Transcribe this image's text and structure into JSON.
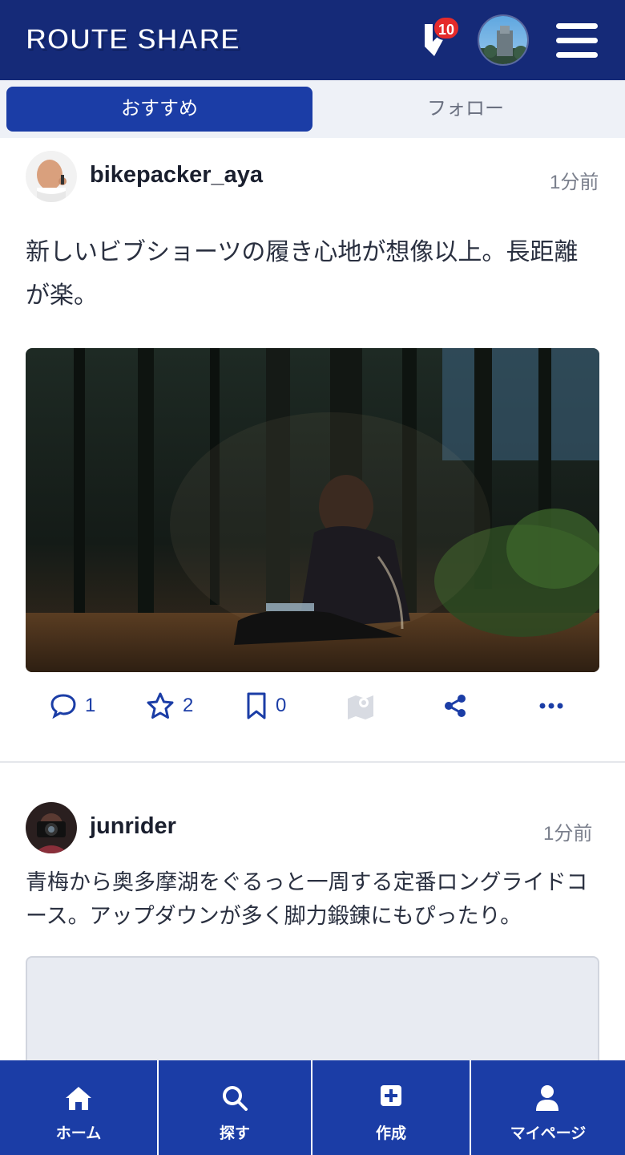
{
  "header": {
    "logo": "ROUTE SHARE",
    "notification_count": "10"
  },
  "tabs": [
    {
      "label": "おすすめ",
      "active": true
    },
    {
      "label": "フォロー",
      "active": false
    }
  ],
  "posts": [
    {
      "username": "bikepacker_aya",
      "time": "1分前",
      "text": "新しいビブショーツの履き心地が想像以上。長距離が楽。",
      "actions": {
        "comments": "1",
        "stars": "2",
        "bookmarks": "0"
      }
    },
    {
      "username": "junrider",
      "time": "1分前",
      "text": "青梅から奥多摩湖をぐるっと一周する定番ロングライドコース。アップダウンが多く脚力鍛錬にもぴったり。"
    }
  ],
  "bottom_nav": [
    {
      "label": "ホーム",
      "icon": "home-icon"
    },
    {
      "label": "探す",
      "icon": "search-icon"
    },
    {
      "label": "作成",
      "icon": "plus-square-icon"
    },
    {
      "label": "マイページ",
      "icon": "user-icon"
    }
  ],
  "colors": {
    "header_bg": "#152a78",
    "primary": "#1b3da6",
    "badge": "#e52b2b",
    "tab_bar_bg": "#eef1f7"
  }
}
